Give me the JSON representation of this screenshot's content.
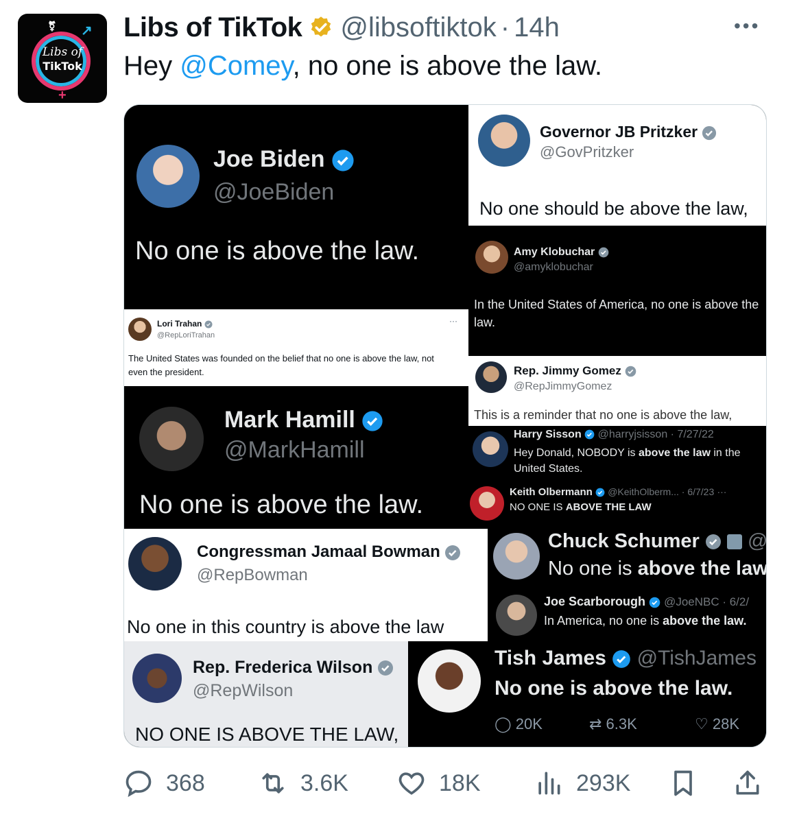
{
  "author": {
    "name": "Libs of TikTok",
    "handle": "@libsoftiktok",
    "separator": "·",
    "time": "14h",
    "avatar_line1": "Libs of",
    "avatar_line2": "TikTok"
  },
  "tweet": {
    "text_prefix": "Hey ",
    "mention": "@Comey",
    "text_suffix": ", no one is above the law."
  },
  "collage": {
    "biden": {
      "name": "Joe Biden",
      "handle": "@JoeBiden",
      "text": "No one is above the law."
    },
    "pritzker": {
      "name": "Governor JB Pritzker",
      "handle": "@GovPritzker",
      "text": "No one should be above the law,"
    },
    "klobuchar": {
      "name": "Amy Klobuchar",
      "handle": "@amyklobuchar",
      "text": "In the United States of America, no one is above the law."
    },
    "trahan": {
      "name": "Lori Trahan",
      "handle": "@RepLoriTrahan",
      "text": "The United States was founded on the belief that no one is above the law, not even the president."
    },
    "gomez": {
      "name": "Rep. Jimmy Gomez",
      "handle": "@RepJimmyGomez",
      "text": "This is a reminder that no one is above the law,"
    },
    "hamill": {
      "name": "Mark Hamill",
      "handle": "@MarkHamill",
      "text": "No one is above the law."
    },
    "sisson": {
      "name": "Harry Sisson",
      "handle": "@harryjsisson · 7/27/22",
      "text_pre": "Hey Donald, NOBODY is ",
      "text_bold": "above the law",
      "text_post": " in the United States."
    },
    "olbermann": {
      "name": "Keith Olbermann",
      "handle": "@KeithOlberm... · 6/7/23",
      "text_pre": "NO ONE IS ",
      "text_bold": "ABOVE THE LAW"
    },
    "bowman": {
      "name": "Congressman Jamaal Bowman",
      "handle": "@RepBowman",
      "text": "No one in this country is above the law"
    },
    "schumer": {
      "name": "Chuck Schumer",
      "handle": "@",
      "text_pre": "No one is ",
      "text_bold": "above the law"
    },
    "scarborough": {
      "name": "Joe Scarborough",
      "handle": "@JoeNBC · 6/2/",
      "text_pre": "In America, no one is ",
      "text_bold": "above the law."
    },
    "wilson": {
      "name": "Rep. Frederica Wilson",
      "handle": "@RepWilson",
      "text": "NO ONE IS ABOVE THE LAW,"
    },
    "james": {
      "name": "Tish James",
      "handle": "@TishJames",
      "text": "No one is above the law.",
      "replies": "20K",
      "retweets": "6.3K",
      "likes": "28K"
    }
  },
  "actions": {
    "replies": "368",
    "retweets": "3.6K",
    "likes": "18K",
    "views": "293K"
  },
  "colors": {
    "accent": "#1d9bf0",
    "verified_gold": "#e8b21e",
    "muted": "#536471"
  }
}
